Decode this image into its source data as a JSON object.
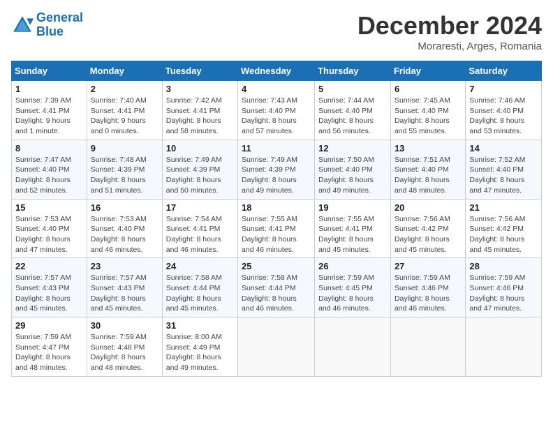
{
  "header": {
    "logo_line1": "General",
    "logo_line2": "Blue",
    "month": "December 2024",
    "location": "Moraresti, Arges, Romania"
  },
  "weekdays": [
    "Sunday",
    "Monday",
    "Tuesday",
    "Wednesday",
    "Thursday",
    "Friday",
    "Saturday"
  ],
  "weeks": [
    [
      {
        "day": "1",
        "info": "Sunrise: 7:39 AM\nSunset: 4:41 PM\nDaylight: 9 hours\nand 1 minute."
      },
      {
        "day": "2",
        "info": "Sunrise: 7:40 AM\nSunset: 4:41 PM\nDaylight: 9 hours\nand 0 minutes."
      },
      {
        "day": "3",
        "info": "Sunrise: 7:42 AM\nSunset: 4:41 PM\nDaylight: 8 hours\nand 58 minutes."
      },
      {
        "day": "4",
        "info": "Sunrise: 7:43 AM\nSunset: 4:40 PM\nDaylight: 8 hours\nand 57 minutes."
      },
      {
        "day": "5",
        "info": "Sunrise: 7:44 AM\nSunset: 4:40 PM\nDaylight: 8 hours\nand 56 minutes."
      },
      {
        "day": "6",
        "info": "Sunrise: 7:45 AM\nSunset: 4:40 PM\nDaylight: 8 hours\nand 55 minutes."
      },
      {
        "day": "7",
        "info": "Sunrise: 7:46 AM\nSunset: 4:40 PM\nDaylight: 8 hours\nand 53 minutes."
      }
    ],
    [
      {
        "day": "8",
        "info": "Sunrise: 7:47 AM\nSunset: 4:40 PM\nDaylight: 8 hours\nand 52 minutes."
      },
      {
        "day": "9",
        "info": "Sunrise: 7:48 AM\nSunset: 4:39 PM\nDaylight: 8 hours\nand 51 minutes."
      },
      {
        "day": "10",
        "info": "Sunrise: 7:49 AM\nSunset: 4:39 PM\nDaylight: 8 hours\nand 50 minutes."
      },
      {
        "day": "11",
        "info": "Sunrise: 7:49 AM\nSunset: 4:39 PM\nDaylight: 8 hours\nand 49 minutes."
      },
      {
        "day": "12",
        "info": "Sunrise: 7:50 AM\nSunset: 4:40 PM\nDaylight: 8 hours\nand 49 minutes."
      },
      {
        "day": "13",
        "info": "Sunrise: 7:51 AM\nSunset: 4:40 PM\nDaylight: 8 hours\nand 48 minutes."
      },
      {
        "day": "14",
        "info": "Sunrise: 7:52 AM\nSunset: 4:40 PM\nDaylight: 8 hours\nand 47 minutes."
      }
    ],
    [
      {
        "day": "15",
        "info": "Sunrise: 7:53 AM\nSunset: 4:40 PM\nDaylight: 8 hours\nand 47 minutes."
      },
      {
        "day": "16",
        "info": "Sunrise: 7:53 AM\nSunset: 4:40 PM\nDaylight: 8 hours\nand 46 minutes."
      },
      {
        "day": "17",
        "info": "Sunrise: 7:54 AM\nSunset: 4:41 PM\nDaylight: 8 hours\nand 46 minutes."
      },
      {
        "day": "18",
        "info": "Sunrise: 7:55 AM\nSunset: 4:41 PM\nDaylight: 8 hours\nand 46 minutes."
      },
      {
        "day": "19",
        "info": "Sunrise: 7:55 AM\nSunset: 4:41 PM\nDaylight: 8 hours\nand 45 minutes."
      },
      {
        "day": "20",
        "info": "Sunrise: 7:56 AM\nSunset: 4:42 PM\nDaylight: 8 hours\nand 45 minutes."
      },
      {
        "day": "21",
        "info": "Sunrise: 7:56 AM\nSunset: 4:42 PM\nDaylight: 8 hours\nand 45 minutes."
      }
    ],
    [
      {
        "day": "22",
        "info": "Sunrise: 7:57 AM\nSunset: 4:43 PM\nDaylight: 8 hours\nand 45 minutes."
      },
      {
        "day": "23",
        "info": "Sunrise: 7:57 AM\nSunset: 4:43 PM\nDaylight: 8 hours\nand 45 minutes."
      },
      {
        "day": "24",
        "info": "Sunrise: 7:58 AM\nSunset: 4:44 PM\nDaylight: 8 hours\nand 45 minutes."
      },
      {
        "day": "25",
        "info": "Sunrise: 7:58 AM\nSunset: 4:44 PM\nDaylight: 8 hours\nand 46 minutes."
      },
      {
        "day": "26",
        "info": "Sunrise: 7:59 AM\nSunset: 4:45 PM\nDaylight: 8 hours\nand 46 minutes."
      },
      {
        "day": "27",
        "info": "Sunrise: 7:59 AM\nSunset: 4:46 PM\nDaylight: 8 hours\nand 46 minutes."
      },
      {
        "day": "28",
        "info": "Sunrise: 7:59 AM\nSunset: 4:46 PM\nDaylight: 8 hours\nand 47 minutes."
      }
    ],
    [
      {
        "day": "29",
        "info": "Sunrise: 7:59 AM\nSunset: 4:47 PM\nDaylight: 8 hours\nand 48 minutes."
      },
      {
        "day": "30",
        "info": "Sunrise: 7:59 AM\nSunset: 4:48 PM\nDaylight: 8 hours\nand 48 minutes."
      },
      {
        "day": "31",
        "info": "Sunrise: 8:00 AM\nSunset: 4:49 PM\nDaylight: 8 hours\nand 49 minutes."
      },
      null,
      null,
      null,
      null
    ]
  ]
}
